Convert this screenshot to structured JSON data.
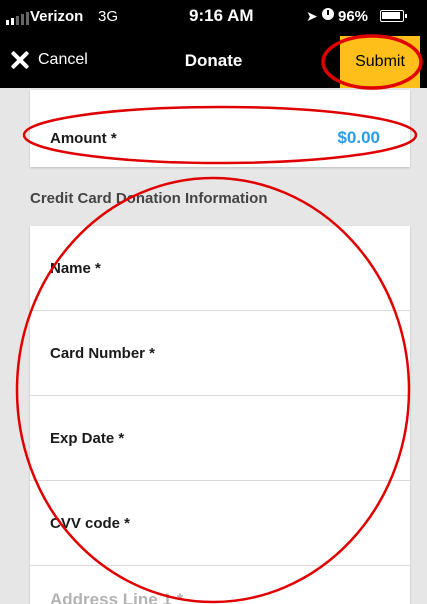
{
  "status_bar": {
    "carrier": "Verizon",
    "network": "3G",
    "time": "9:16 AM",
    "battery": "96%"
  },
  "nav": {
    "cancel_label": "Cancel",
    "title": "Donate",
    "submit_label": "Submit"
  },
  "amount": {
    "label": "Amount *",
    "value": "$0.00"
  },
  "section_title": "Credit Card Donation Information",
  "fields": {
    "name": "Name *",
    "card_number": "Card Number *",
    "exp_date": "Exp Date *",
    "cvv": "CVV code *",
    "address_line_1": "Address Line 1 *"
  },
  "colors": {
    "accent": "#ffbf1a",
    "amount_value": "#2a9ce8",
    "annotation": "#e00000"
  }
}
